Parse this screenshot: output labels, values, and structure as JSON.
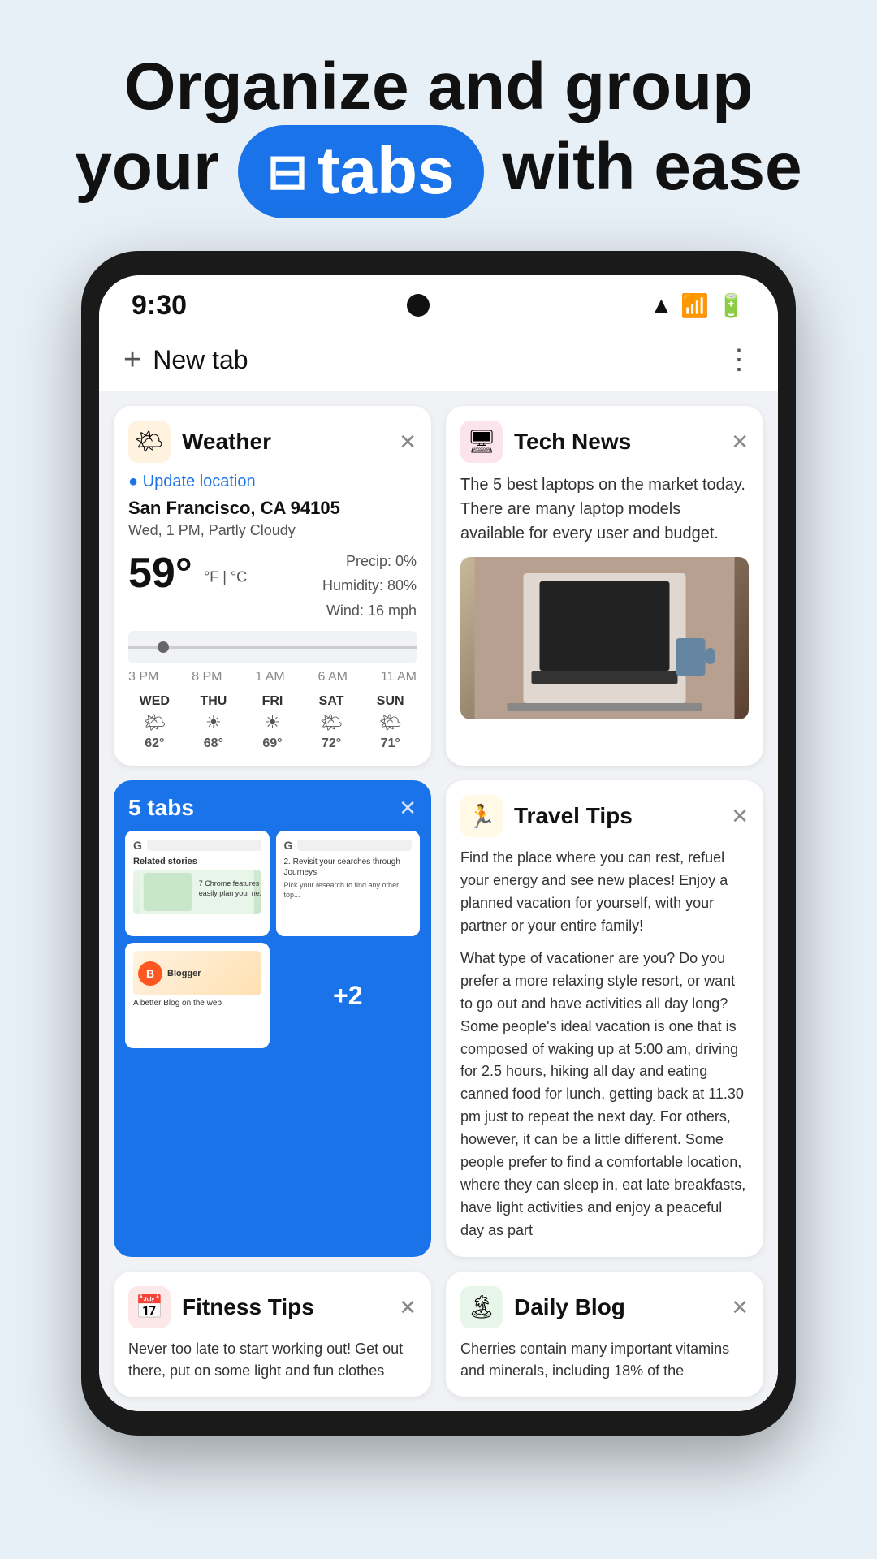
{
  "hero": {
    "line1": "Organize and group",
    "line2_prefix": "your",
    "pill_icon": "⊟",
    "pill_text": "tabs",
    "line2_suffix": "with ease"
  },
  "status_bar": {
    "time": "9:30"
  },
  "chrome_bar": {
    "plus": "+",
    "new_tab": "New tab",
    "menu": "⋮"
  },
  "cards": {
    "weather": {
      "title": "Weather",
      "close": "✕",
      "update_location": "Update location",
      "location": "San Francisco, CA 94105",
      "description": "Wed, 1 PM, Partly Cloudy",
      "temp": "59",
      "unit": "°F | °C",
      "precip": "Precip: 0%",
      "humidity": "Humidity: 80%",
      "wind": "Wind: 16 mph",
      "times": [
        "3 PM",
        "8 PM",
        "1 AM",
        "6 AM",
        "11 AM"
      ],
      "forecast": [
        {
          "day": "WED",
          "icon": "🌤",
          "temp": "62°"
        },
        {
          "day": "THU",
          "icon": "☀",
          "temp": "68°"
        },
        {
          "day": "FRI",
          "icon": "☀",
          "temp": "69°"
        },
        {
          "day": "SAT",
          "icon": "🌤",
          "temp": "72°"
        },
        {
          "day": "SUN",
          "icon": "🌤",
          "temp": "71°"
        }
      ]
    },
    "tech_news": {
      "title": "Tech News",
      "close": "✕",
      "text": "The 5 best laptops on the market today. There are many laptop models available for every user and budget."
    },
    "tabs_group": {
      "label": "5 tabs",
      "close": "✕",
      "plus_label": "+2"
    },
    "travel_tips": {
      "title": "Travel Tips",
      "close": "✕",
      "para1": "Find the place where you can rest, refuel your energy and see new places! Enjoy a planned vacation for yourself, with your partner or your entire family!",
      "para2": "What type of vacationer are you? Do you prefer a more relaxing style resort, or want to go out and have activities all day long? Some people's ideal vacation is one that is composed of waking up at 5:00 am, driving for 2.5 hours, hiking all day and eating canned food for lunch, getting back at 11.30 pm just to repeat the next day. For others, however, it can be a little different. Some people prefer to find a comfortable location, where they can sleep in, eat late breakfasts, have light activities and enjoy a peaceful day as part"
    },
    "fitness_tips": {
      "title": "Fitness Tips",
      "close": "✕",
      "text": "Never too late to start working out! Get out there, put on some light and fun clothes"
    },
    "daily_blog": {
      "title": "Daily Blog",
      "close": "✕",
      "text": "Cherries contain many important vitamins and minerals, including 18% of the"
    }
  }
}
